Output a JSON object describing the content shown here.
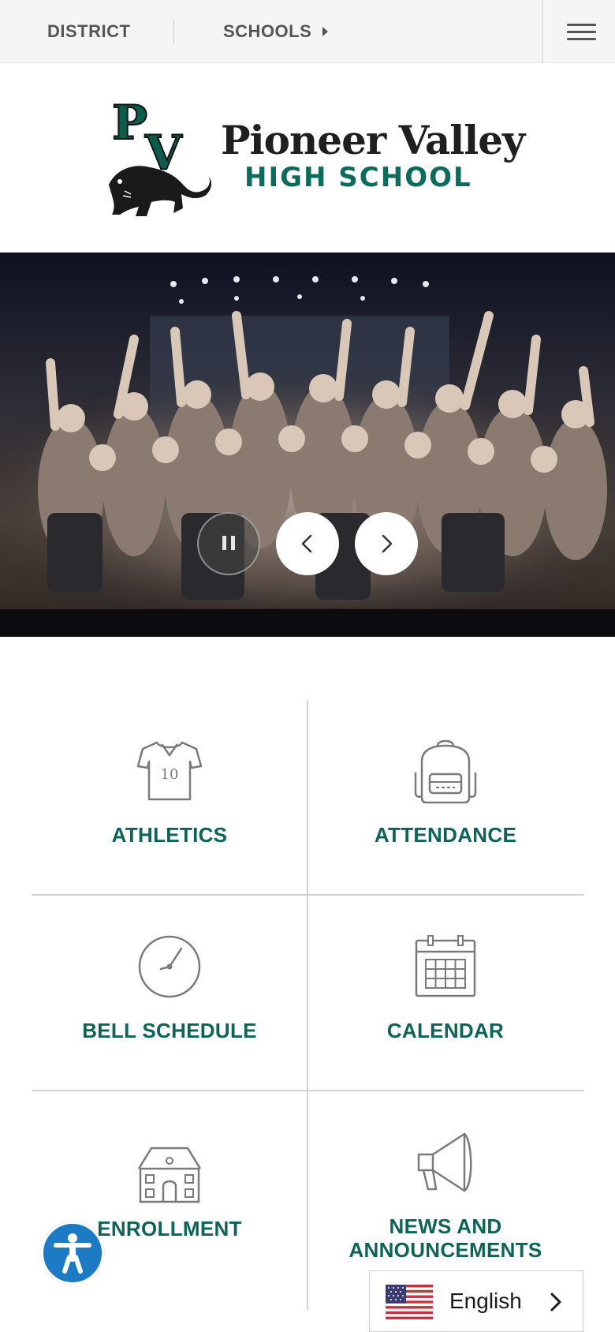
{
  "topbar": {
    "district_label": "DISTRICT",
    "schools_label": "SCHOOLS"
  },
  "logo": {
    "monogram": "PV",
    "name_line1": "Pioneer Valley",
    "name_line2": "HIGH SCHOOL"
  },
  "hero": {
    "controls": [
      "pause-icon",
      "chevron-left-icon",
      "chevron-right-icon"
    ]
  },
  "quick_links": [
    {
      "label": "ATHLETICS",
      "icon": "jersey-icon",
      "jersey_number": "10"
    },
    {
      "label": "ATTENDANCE",
      "icon": "backpack-icon"
    },
    {
      "label": "BELL SCHEDULE",
      "icon": "clock-icon"
    },
    {
      "label": "CALENDAR",
      "icon": "calendar-icon"
    },
    {
      "label": "ENROLLMENT",
      "icon": "school-building-icon"
    },
    {
      "label": "NEWS AND",
      "label_line2": "ANNOUNCEMENTS",
      "icon": "megaphone-icon"
    }
  ],
  "language": {
    "selected": "English",
    "flag": "us-flag-icon"
  },
  "colors": {
    "accent": "#0d6355",
    "brand_green": "#0c6b5a",
    "accessibility_blue": "#1c7bc4",
    "topbar_bg": "#f5f5f5"
  }
}
